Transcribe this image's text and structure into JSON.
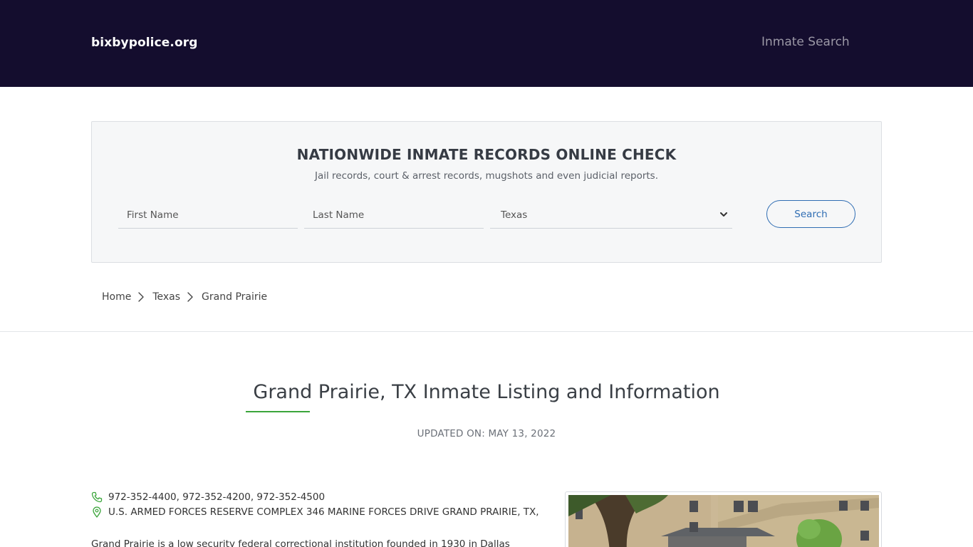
{
  "header": {
    "brand": "bixbypolice.org",
    "nav_link": "Inmate Search",
    "bg_color": "#140d2e"
  },
  "search": {
    "title": "NATIONWIDE INMATE RECORDS ONLINE CHECK",
    "subtitle": "Jail records, court & arrest records, mugshots and even judicial reports.",
    "first_name_placeholder": "First Name",
    "last_name_placeholder": "Last Name",
    "state_selected": "Texas",
    "button_label": "Search",
    "accent_color": "#2f6db3"
  },
  "breadcrumb": {
    "items": [
      "Home",
      "Texas",
      "Grand Prairie"
    ]
  },
  "page": {
    "title": "Grand Prairie, TX Inmate Listing and Information",
    "updated": "UPDATED ON: MAY 13, 2022",
    "underline_color": "#3aa53a"
  },
  "facility": {
    "phones": "972-352-4400, 972-352-4200, 972-352-4500",
    "address": "U.S. ARMED FORCES RESERVE COMPLEX 346 MARINE FORCES DRIVE GRAND PRAIRIE, TX,",
    "description": "Grand Prairie is a low security federal correctional institution founded in 1930 in Dallas",
    "icons": [
      "phone-icon",
      "map-pin-icon"
    ],
    "icon_color": "#3aa53a"
  }
}
